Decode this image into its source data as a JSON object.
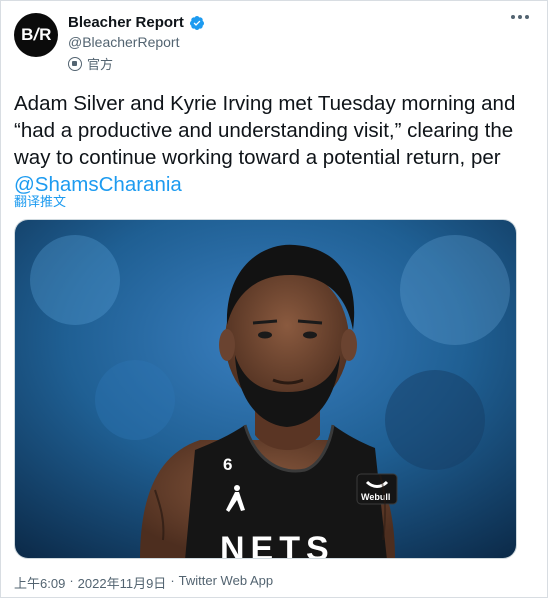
{
  "account": {
    "display_name": "Bleacher Report",
    "handle": "@BleacherReport",
    "official_label": "官方",
    "avatar_text_left": "B",
    "avatar_text_right": "R",
    "verified_color": "#1d9bf0"
  },
  "tweet": {
    "text_before_mention": "Adam Silver and Kyrie Irving met Tuesday morning and “had a productive and understanding visit,” clearing the way to continue working toward a potential return, per ",
    "mention": "@ShamsCharania",
    "translate_label": "翻译推文"
  },
  "media": {
    "jersey_number": "6",
    "sponsor": "Webull",
    "jersey_text": "NETS",
    "background_color": "#1f5f93"
  },
  "meta": {
    "time": "上午6:09",
    "separator": "·",
    "date": "2022年11月9日",
    "separator2": "·",
    "source": "Twitter Web App"
  },
  "icons": {
    "verified": "verified-badge-icon",
    "more": "more-options-icon",
    "official": "official-label-icon"
  }
}
